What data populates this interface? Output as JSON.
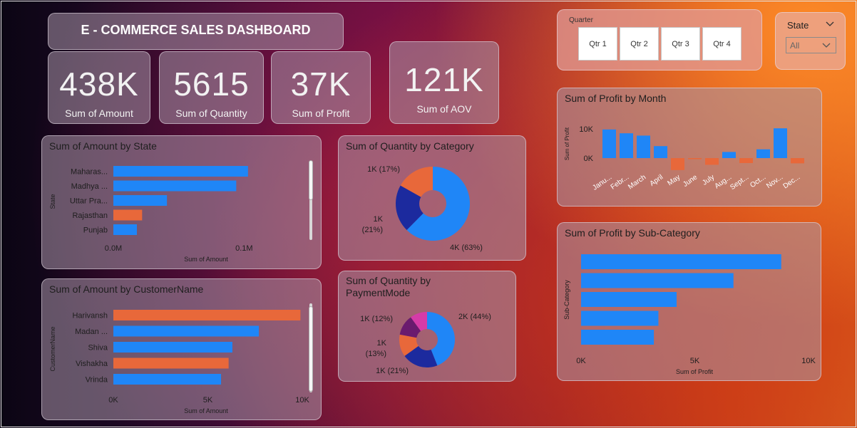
{
  "dashboard_title": "E - COMMERCE SALES DASHBOARD",
  "kpis": [
    {
      "value": "438K",
      "label": "Sum of Amount"
    },
    {
      "value": "5615",
      "label": "Sum of Quantity"
    },
    {
      "value": "37K",
      "label": "Sum of Profit"
    },
    {
      "value": "121K",
      "label": "Sum of AOV"
    }
  ],
  "quarter_slicer": {
    "title": "Quarter",
    "options": [
      "Qtr 1",
      "Qtr 2",
      "Qtr 3",
      "Qtr 4"
    ]
  },
  "state_slicer": {
    "title": "State",
    "selected": "All"
  },
  "colors": {
    "blue": "#1f86f7",
    "orange": "#e8683a",
    "navy": "#1c2a9e",
    "purple": "#6a1b6e",
    "pink": "#d63ba8",
    "axis": "#1e1e1e"
  },
  "chart_data": [
    {
      "id": "amount_by_state",
      "type": "bar",
      "orientation": "horizontal",
      "title": "Sum of Amount by State",
      "xlabel": "Sum of Amount",
      "ylabel": "State",
      "categories": [
        "Maharas...",
        "Madhya ...",
        "Uttar Pra...",
        "Rajasthan",
        "Punjab"
      ],
      "values": [
        0.103,
        0.094,
        0.041,
        0.022,
        0.018
      ],
      "highlight": [
        false,
        false,
        false,
        true,
        false
      ],
      "xlim": [
        0,
        0.15
      ],
      "xticks": [
        {
          "v": 0,
          "label": "0.0M"
        },
        {
          "v": 0.1,
          "label": "0.1M"
        }
      ],
      "grid": false
    },
    {
      "id": "amount_by_customer",
      "type": "bar",
      "orientation": "horizontal",
      "title": "Sum of Amount by CustomerName",
      "xlabel": "Sum of Amount",
      "ylabel": "CustomerName",
      "categories": [
        "Harivansh",
        "Madan ...",
        "Shiva",
        "Vishakha",
        "Vrinda"
      ],
      "values": [
        9900,
        7700,
        6300,
        6100,
        5700
      ],
      "highlight": [
        true,
        false,
        false,
        true,
        false
      ],
      "xlim": [
        0,
        10000
      ],
      "xticks": [
        {
          "v": 0,
          "label": "0K"
        },
        {
          "v": 5000,
          "label": "5K"
        },
        {
          "v": 10000,
          "label": "10K"
        }
      ],
      "grid": false
    },
    {
      "id": "quantity_by_category",
      "type": "pie",
      "donut": true,
      "title": "Sum of Quantity by Category",
      "slices": [
        {
          "value": 63,
          "label": "4K (63%)",
          "color": "#1f86f7"
        },
        {
          "value": 21,
          "label": "1K (21%)",
          "color": "#1c2a9e"
        },
        {
          "value": 17,
          "label": "1K (17%)",
          "color": "#e8683a"
        }
      ]
    },
    {
      "id": "quantity_by_paymentmode",
      "type": "pie",
      "donut": true,
      "title": "Sum of Quantity by PaymentMode",
      "slices": [
        {
          "value": 44,
          "label": "2K (44%)",
          "color": "#1f86f7"
        },
        {
          "value": 21,
          "label": "1K (21%)",
          "color": "#1c2a9e"
        },
        {
          "value": 13,
          "label": "1K (13%)",
          "color": "#e8683a"
        },
        {
          "value": 12,
          "label": "1K (12%)",
          "color": "#6a1b6e"
        },
        {
          "value": 10,
          "label": "",
          "color": "#d63ba8"
        }
      ]
    },
    {
      "id": "profit_by_month",
      "type": "bar",
      "orientation": "vertical",
      "title": "Sum of Profit by Month",
      "ylabel": "Sum of Profit",
      "categories": [
        "Janu...",
        "Febr...",
        "March",
        "April",
        "May",
        "June",
        "July",
        "Aug...",
        "Sept...",
        "Oct...",
        "Nov...",
        "Dec..."
      ],
      "values": [
        9800,
        8500,
        7700,
        4100,
        -4100,
        -200,
        -2300,
        2100,
        -1700,
        3000,
        10200,
        -1800
      ],
      "ylim": [
        -5000,
        12000
      ],
      "yticks": [
        {
          "v": 0,
          "label": "0K"
        },
        {
          "v": 10000,
          "label": "10K"
        }
      ],
      "grid": false
    },
    {
      "id": "profit_by_subcategory",
      "type": "bar",
      "orientation": "horizontal",
      "title": "Sum of Profit by Sub-Category",
      "xlabel": "Sum of Profit",
      "ylabel": "Sub-Category",
      "categories": [],
      "values": [
        8800,
        6700,
        4200,
        3400,
        3200
      ],
      "xlim": [
        0,
        10000
      ],
      "xticks": [
        {
          "v": 0,
          "label": "0K"
        },
        {
          "v": 5000,
          "label": "5K"
        },
        {
          "v": 10000,
          "label": "10K"
        }
      ],
      "grid": false
    }
  ]
}
